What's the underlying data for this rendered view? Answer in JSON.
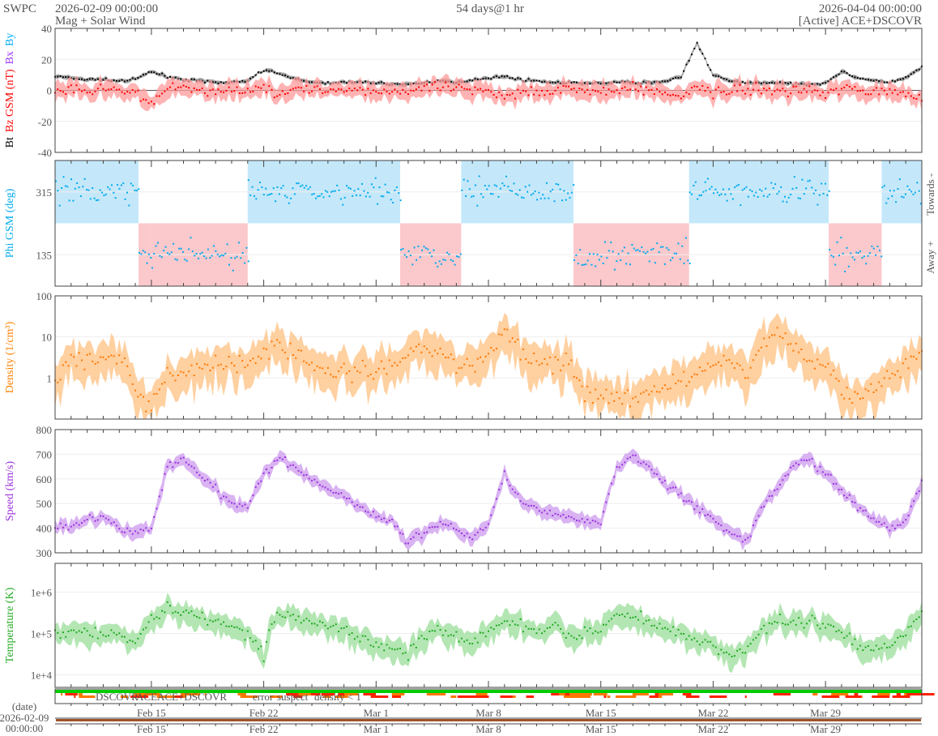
{
  "header": {
    "org": "SWPC",
    "start": "2026-02-09 00:00:00",
    "subtitle": "Mag + Solar Wind",
    "span": "54 days@1 hr",
    "end": "2026-04-04 00:00:00",
    "source": "[Active] ACE+DSCOVR"
  },
  "x_axis": {
    "days": 54,
    "ticks": [
      {
        "day": 6,
        "label": "Feb 15"
      },
      {
        "day": 13,
        "label": "Feb 22"
      },
      {
        "day": 20,
        "label": "Mar 1"
      },
      {
        "day": 27,
        "label": "Mar 8"
      },
      {
        "day": 34,
        "label": "Mar 15"
      },
      {
        "day": 41,
        "label": "Mar 22"
      },
      {
        "day": 48,
        "label": "Mar 29"
      }
    ],
    "date_label": "(date)",
    "date_start_day": "2026-02-09",
    "date_start_time": "00:00:00"
  },
  "source_legend": [
    {
      "label": "DSCOVR",
      "color": "#0000ff"
    },
    {
      "label": "ACE",
      "color": "#00cc00"
    },
    {
      "label": "ACE+DSCOVR",
      "color": "#ff00ff"
    },
    {
      "label": "error",
      "color": "#ff0000"
    },
    {
      "label": "suspect",
      "color": "#e6c800"
    },
    {
      "label": "density < 1",
      "color": "#ff8000"
    }
  ],
  "chart_data": [
    {
      "type": "scatter",
      "id": "mag",
      "ylabels": [
        {
          "text": "Bt",
          "color": "#000000"
        },
        {
          "text": "Bz GSM (nT)",
          "color": "#ff0000"
        },
        {
          "text": "Bx",
          "color": "#9933ff"
        },
        {
          "text": "By",
          "color": "#00aaff"
        }
      ],
      "scale": "linear",
      "ylim": [
        -40,
        40
      ],
      "yticks": [
        {
          "v": 40,
          "label": "40"
        },
        {
          "v": 20,
          "label": "20"
        },
        {
          "v": 0,
          "label": "0"
        },
        {
          "v": -20,
          "label": "-20"
        },
        {
          "v": -40,
          "label": "-40"
        }
      ],
      "series": [
        {
          "name": "Bt",
          "color": "#000000",
          "band": "#888888",
          "noise": 0.6,
          "values": [
            9,
            8,
            7,
            7,
            6,
            7,
            12,
            9,
            7,
            6,
            5,
            5,
            6,
            13,
            11,
            7,
            5,
            5,
            5,
            5,
            5,
            4,
            4,
            5,
            6,
            5,
            7,
            8,
            9,
            7,
            6,
            5,
            5,
            4,
            5,
            5,
            5,
            5,
            6,
            9,
            30,
            10,
            6,
            5,
            5,
            5,
            4,
            4,
            5,
            12,
            8,
            6,
            5,
            8,
            15
          ]
        },
        {
          "name": "Bz GSM",
          "color": "#ff0000",
          "band": "#ff9999",
          "noise": 2.5,
          "values": [
            -1,
            0,
            -2,
            1,
            -1,
            -2,
            -8,
            2,
            1,
            0,
            -1,
            0,
            1,
            3,
            -2,
            1,
            0,
            -1,
            0,
            1,
            -1,
            0,
            -1,
            0,
            2,
            1,
            -1,
            0,
            -4,
            -1,
            0,
            0,
            1,
            0,
            -1,
            0,
            1,
            0,
            -2,
            -5,
            3,
            -1,
            0,
            0,
            1,
            -1,
            0,
            0,
            -1,
            1,
            0,
            -1,
            0,
            -2,
            -4
          ]
        }
      ]
    },
    {
      "type": "scatter",
      "id": "phi",
      "ylabels": [
        {
          "text": "Phi GSM (deg)",
          "color": "#00aaee"
        }
      ],
      "right_labels": [
        "Towards -",
        "Away +"
      ],
      "scale": "linear",
      "ylim": [
        45,
        405
      ],
      "yticks": [
        {
          "v": 315,
          "label": "315"
        },
        {
          "v": 135,
          "label": "135"
        }
      ],
      "sectors": [
        {
          "from": 0,
          "to": 5.2,
          "polarity": "towards"
        },
        {
          "from": 5.2,
          "to": 6.0,
          "polarity": "away"
        },
        {
          "from": 6.0,
          "to": 12.0,
          "polarity": "away"
        },
        {
          "from": 12.0,
          "to": 21.5,
          "polarity": "towards"
        },
        {
          "from": 21.5,
          "to": 25.3,
          "polarity": "away"
        },
        {
          "from": 25.3,
          "to": 32.3,
          "polarity": "towards"
        },
        {
          "from": 32.3,
          "to": 39.5,
          "polarity": "away"
        },
        {
          "from": 39.5,
          "to": 40.5,
          "polarity": "towards"
        },
        {
          "from": 40.5,
          "to": 48.2,
          "polarity": "towards"
        },
        {
          "from": 48.2,
          "to": 51.5,
          "polarity": "away"
        },
        {
          "from": 51.5,
          "to": 54,
          "polarity": "towards"
        }
      ],
      "towards_value": 315,
      "away_value": 135,
      "series": [
        {
          "name": "Phi GSM",
          "color": "#00aaee"
        }
      ]
    },
    {
      "type": "scatter",
      "id": "density",
      "ylabels": [
        {
          "text": "Density (1/cm³)",
          "color": "#ff8000"
        }
      ],
      "scale": "log",
      "ylim": [
        0.1,
        100
      ],
      "yticks": [
        {
          "v": 100,
          "label": "100"
        },
        {
          "v": 10,
          "label": "10"
        },
        {
          "v": 1,
          "label": "1"
        }
      ],
      "series": [
        {
          "name": "Density",
          "color": "#ff7700",
          "band": "#ffc080",
          "noise": 0.35,
          "values": [
            0.5,
            3,
            3,
            3,
            2.5,
            0.5,
            0.2,
            1,
            1.5,
            1.5,
            2,
            2,
            3,
            3.5,
            6,
            4,
            2,
            1.5,
            1.2,
            1.5,
            1.3,
            1.5,
            3,
            5,
            4,
            1.5,
            2,
            3,
            15,
            4,
            3,
            2.5,
            2.5,
            0.4,
            0.3,
            0.4,
            0.3,
            0.4,
            0.5,
            1,
            1.5,
            2,
            3,
            1,
            5,
            15,
            5,
            3,
            2,
            0.5,
            0.3,
            0.5,
            1,
            2,
            5
          ]
        }
      ]
    },
    {
      "type": "scatter",
      "id": "speed",
      "ylabels": [
        {
          "text": "Speed (km/s)",
          "color": "#9933dd"
        }
      ],
      "scale": "linear",
      "ylim": [
        300,
        800
      ],
      "yticks": [
        {
          "v": 800,
          "label": "800"
        },
        {
          "v": 700,
          "label": "700"
        },
        {
          "v": 600,
          "label": "600"
        },
        {
          "v": 500,
          "label": "500"
        },
        {
          "v": 400,
          "label": "400"
        },
        {
          "v": 300,
          "label": "300"
        }
      ],
      "series": [
        {
          "name": "Speed",
          "color": "#9933dd",
          "band": "#cc99ee",
          "noise": 12,
          "values": [
            410,
            400,
            440,
            450,
            400,
            380,
            400,
            650,
            680,
            620,
            560,
            500,
            490,
            620,
            690,
            640,
            600,
            560,
            530,
            480,
            450,
            420,
            340,
            390,
            420,
            400,
            360,
            420,
            620,
            510,
            480,
            460,
            450,
            430,
            420,
            650,
            690,
            650,
            580,
            530,
            480,
            430,
            380,
            340,
            480,
            560,
            650,
            680,
            620,
            560,
            480,
            440,
            390,
            430,
            590
          ]
        }
      ]
    },
    {
      "type": "scatter",
      "id": "temperature",
      "ylabels": [
        {
          "text": "Temperature (K)",
          "color": "#22aa22"
        }
      ],
      "scale": "log",
      "ylim": [
        5000,
        5000000
      ],
      "yticks": [
        {
          "v": 1000000,
          "label": "1e+6"
        },
        {
          "v": 100000,
          "label": "1e+5"
        },
        {
          "v": 10000,
          "label": "1e+4"
        }
      ],
      "series": [
        {
          "name": "Temperature",
          "color": "#22aa22",
          "band": "#99dd99",
          "noise": 0.2,
          "values": [
            100000,
            120000,
            110000,
            100000,
            90000,
            70000,
            200000,
            400000,
            300000,
            250000,
            200000,
            150000,
            90000,
            30000,
            300000,
            250000,
            200000,
            150000,
            120000,
            80000,
            60000,
            40000,
            30000,
            100000,
            120000,
            80000,
            60000,
            100000,
            200000,
            150000,
            100000,
            150000,
            80000,
            100000,
            120000,
            300000,
            300000,
            200000,
            120000,
            90000,
            60000,
            50000,
            30000,
            40000,
            100000,
            200000,
            200000,
            200000,
            150000,
            100000,
            60000,
            40000,
            50000,
            100000,
            300000
          ]
        }
      ]
    }
  ]
}
